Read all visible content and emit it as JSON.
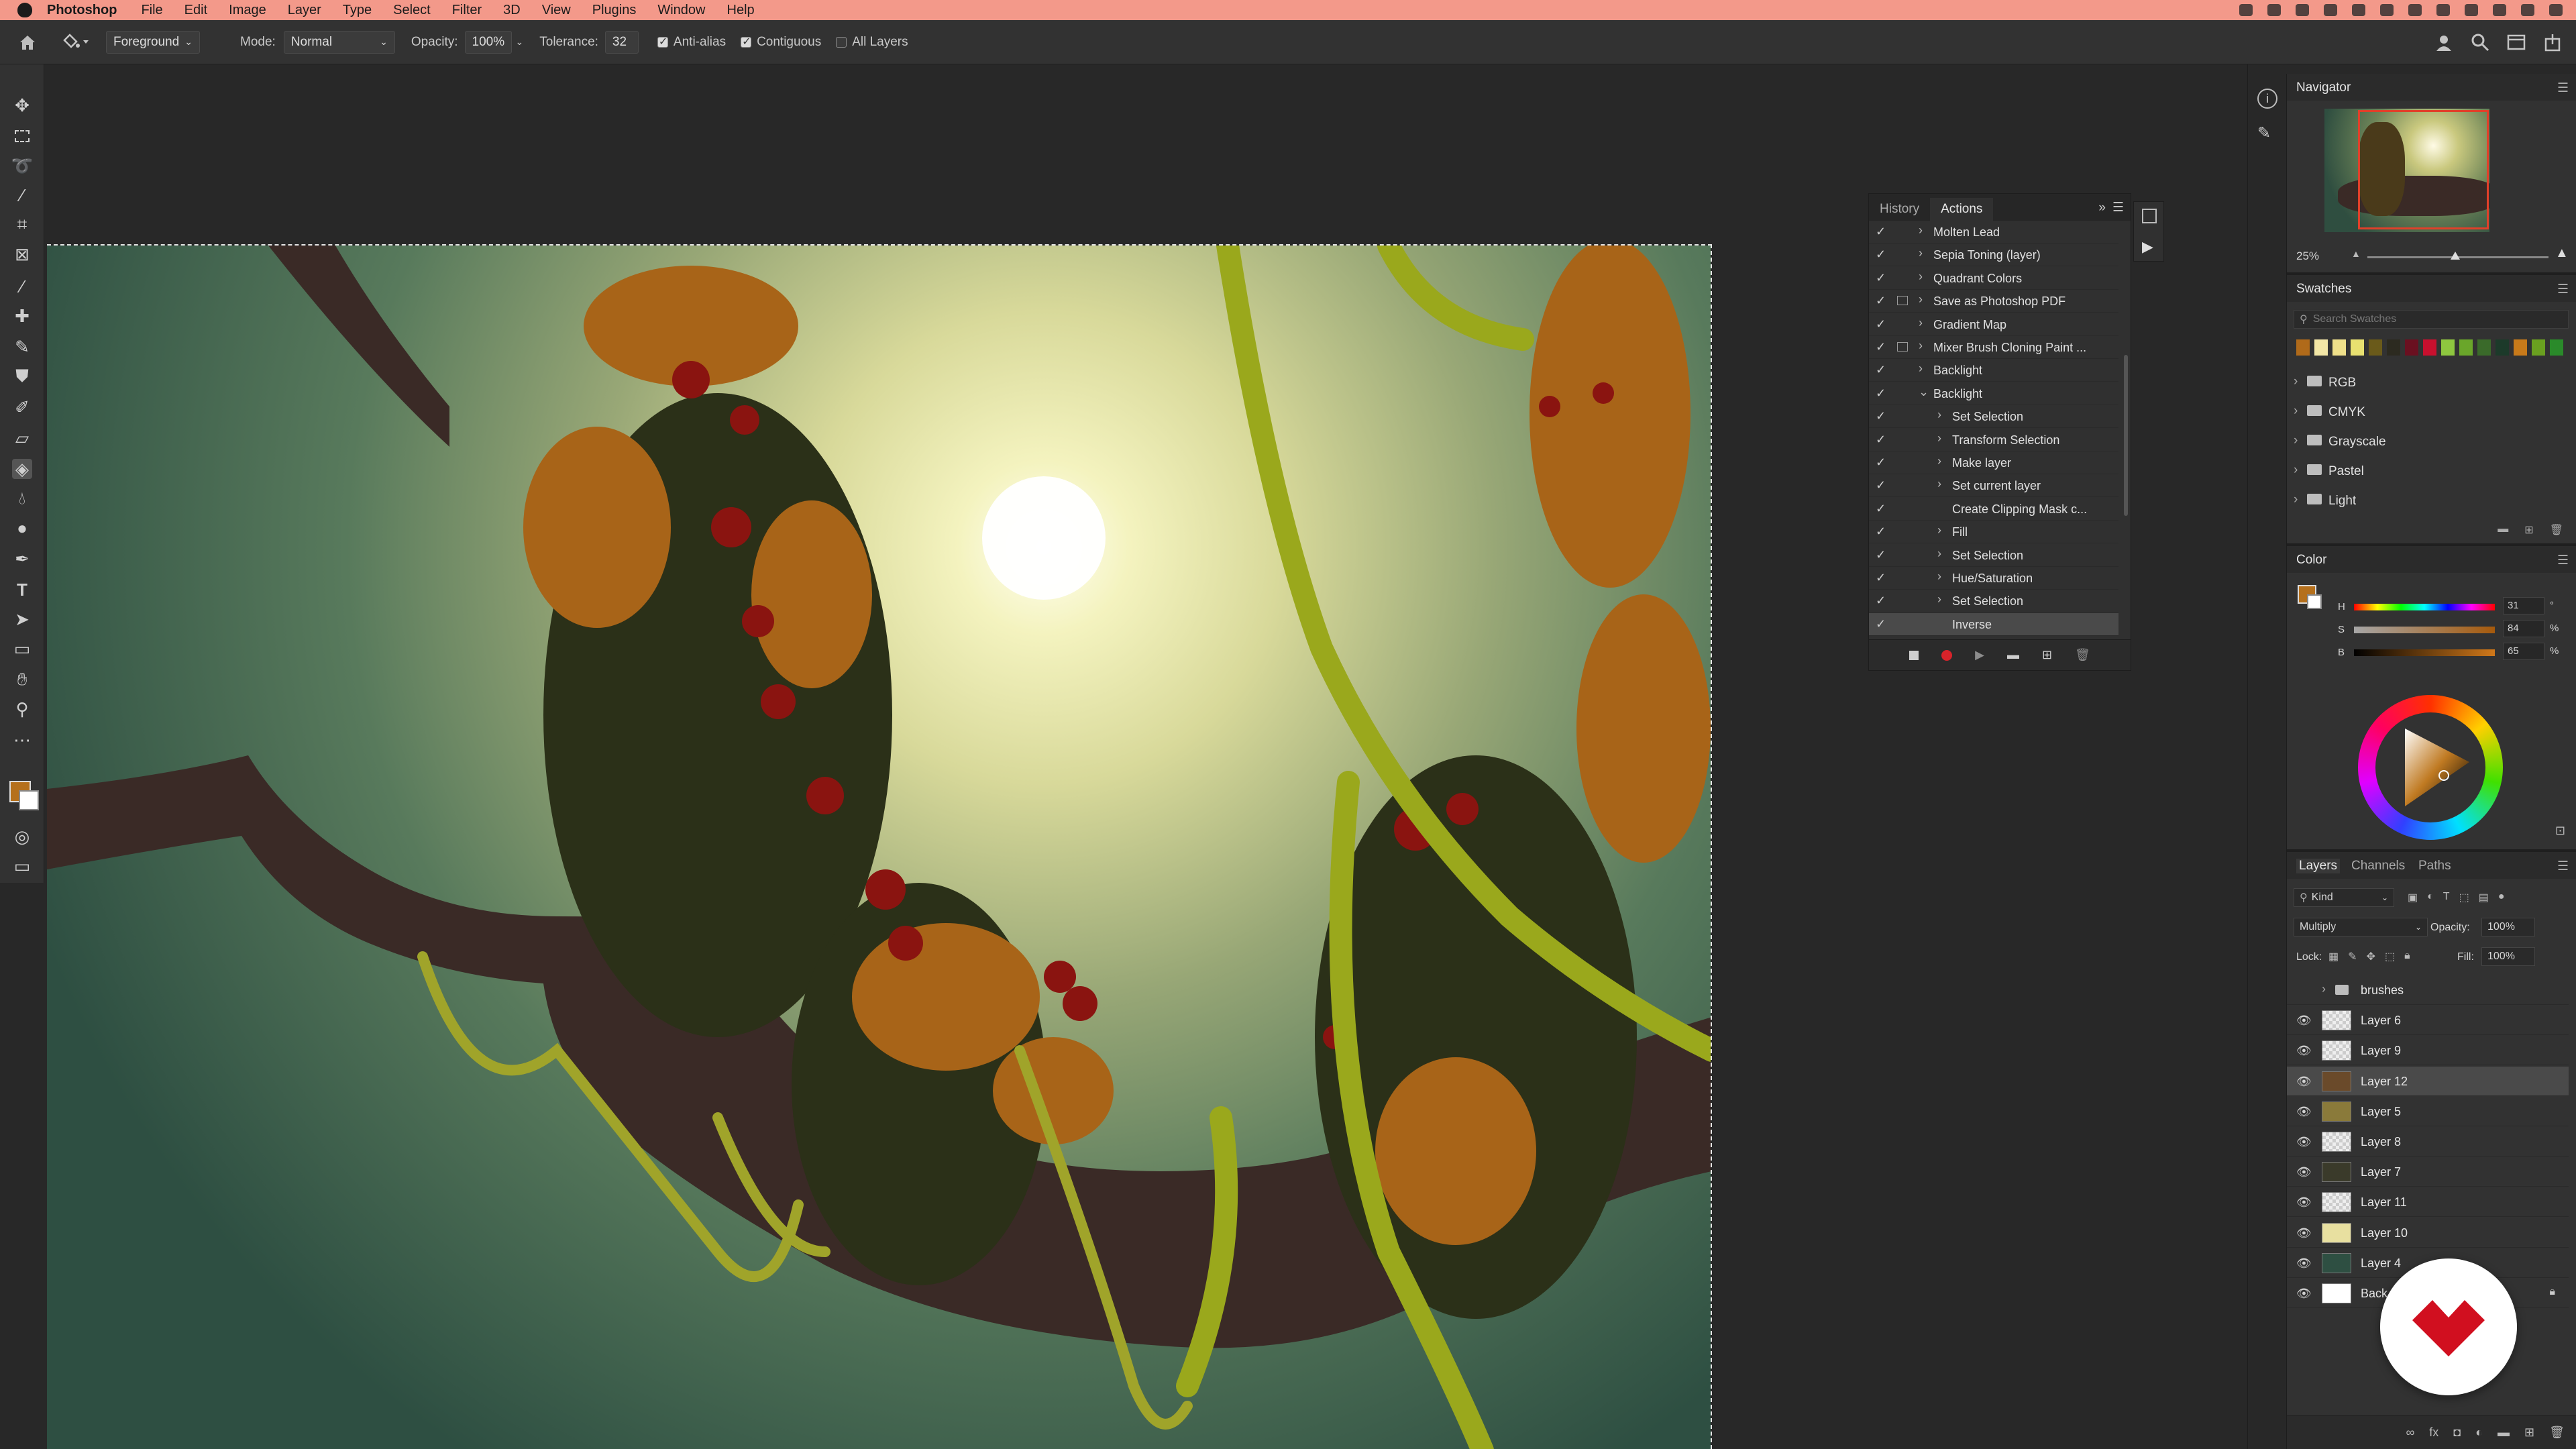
{
  "menubar": {
    "app_name": "Photoshop",
    "menus": [
      "File",
      "Edit",
      "Image",
      "Layer",
      "Type",
      "Select",
      "Filter",
      "3D",
      "View",
      "Plugins",
      "Window",
      "Help"
    ]
  },
  "options_bar": {
    "fill_source": "Foreground",
    "mode_label": "Mode:",
    "mode_value": "Normal",
    "opacity_label": "Opacity:",
    "opacity_value": "100%",
    "tolerance_label": "Tolerance:",
    "tolerance_value": "32",
    "anti_alias_label": "Anti-alias",
    "anti_alias_checked": true,
    "contiguous_label": "Contiguous",
    "contiguous_checked": true,
    "all_layers_label": "All Layers",
    "all_layers_checked": false
  },
  "colors": {
    "foreground": "#b5701c",
    "background": "#ffffff",
    "menubar": "#f3998a",
    "badge_red": "#d10f1f"
  },
  "actions_panel": {
    "tabs": [
      "History",
      "Actions"
    ],
    "active_tab": "Actions",
    "items": [
      {
        "label": "Molten Lead",
        "level": 0,
        "expanded": false,
        "dialog": false
      },
      {
        "label": "Sepia Toning (layer)",
        "level": 0,
        "expanded": false,
        "dialog": false
      },
      {
        "label": "Quadrant Colors",
        "level": 0,
        "expanded": false,
        "dialog": false
      },
      {
        "label": "Save as Photoshop PDF",
        "level": 0,
        "expanded": false,
        "dialog": true
      },
      {
        "label": "Gradient Map",
        "level": 0,
        "expanded": false,
        "dialog": false
      },
      {
        "label": "Mixer Brush Cloning Paint ...",
        "level": 0,
        "expanded": false,
        "dialog": true
      },
      {
        "label": "Backlight",
        "level": 0,
        "expanded": false,
        "dialog": false
      },
      {
        "label": "Backlight",
        "level": 0,
        "expanded": true,
        "dialog": false
      },
      {
        "label": "Set Selection",
        "level": 1,
        "expanded": false,
        "dialog": false
      },
      {
        "label": "Transform Selection",
        "level": 1,
        "expanded": false,
        "dialog": false
      },
      {
        "label": "Make layer",
        "level": 1,
        "expanded": false,
        "dialog": false
      },
      {
        "label": "Set current layer",
        "level": 1,
        "expanded": false,
        "dialog": false
      },
      {
        "label": "Create Clipping Mask c...",
        "level": 1,
        "expanded": null,
        "dialog": false
      },
      {
        "label": "Fill",
        "level": 1,
        "expanded": false,
        "dialog": false
      },
      {
        "label": "Set Selection",
        "level": 1,
        "expanded": false,
        "dialog": false
      },
      {
        "label": "Hue/Saturation",
        "level": 1,
        "expanded": false,
        "dialog": false
      },
      {
        "label": "Set Selection",
        "level": 1,
        "expanded": false,
        "dialog": false
      },
      {
        "label": "Inverse",
        "level": 1,
        "expanded": null,
        "dialog": false,
        "selected": true
      }
    ]
  },
  "navigator": {
    "title": "Navigator",
    "zoom": "25%"
  },
  "swatches": {
    "title": "Swatches",
    "search_placeholder": "Search Swatches",
    "recent": [
      "#b06a1a",
      "#f2e6a6",
      "#efe08a",
      "#e8e070",
      "#6a5a1a",
      "#2c2a20",
      "#6a1020",
      "#c8102e",
      "#8ec63f",
      "#6aa62a",
      "#3a6a2a",
      "#1c3a2a",
      "#c87a1a",
      "#6aa020",
      "#2a8a2a"
    ],
    "groups": [
      "RGB",
      "CMYK",
      "Grayscale",
      "Pastel",
      "Light"
    ]
  },
  "color_panel": {
    "title": "Color",
    "h_label": "H",
    "h_value": "31",
    "h_unit": "°",
    "s_label": "S",
    "s_value": "84",
    "s_unit": "%",
    "b_label": "B",
    "b_value": "65",
    "b_unit": "%"
  },
  "layers_panel": {
    "tabs": [
      "Layers",
      "Channels",
      "Paths"
    ],
    "active_tab": "Layers",
    "filter_kind": "Kind",
    "blend_mode": "Multiply",
    "opacity_label": "Opacity:",
    "opacity_value": "100%",
    "lock_label": "Lock:",
    "fill_label": "Fill:",
    "fill_value": "100%",
    "layers": [
      {
        "name": "brushes",
        "type": "group",
        "visible": false
      },
      {
        "name": "Layer 6",
        "visible": true
      },
      {
        "name": "Layer 9",
        "visible": true
      },
      {
        "name": "Layer 12",
        "visible": true,
        "selected": true
      },
      {
        "name": "Layer 5",
        "visible": true
      },
      {
        "name": "Layer 8",
        "visible": true
      },
      {
        "name": "Layer 7",
        "visible": true
      },
      {
        "name": "Layer 11",
        "visible": true
      },
      {
        "name": "Layer 10",
        "visible": true
      },
      {
        "name": "Layer 4",
        "visible": true
      },
      {
        "name": "Back",
        "visible": true,
        "locked": true
      }
    ]
  }
}
